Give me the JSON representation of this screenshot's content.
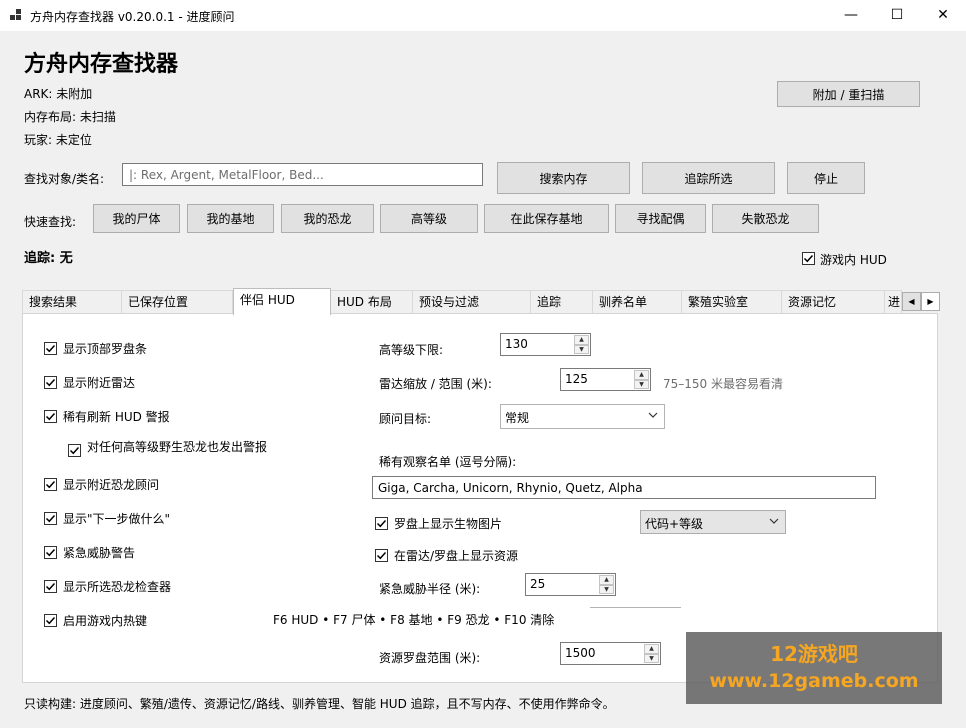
{
  "window": {
    "title": "方舟内存查找器 v0.20.0.1 - 进度顾问",
    "minimize": "—",
    "maximize": "☐",
    "close": "✕"
  },
  "header": {
    "app_title": "方舟内存查找器",
    "ark_status": "ARK: 未附加",
    "memory_status": "内存布局: 未扫描",
    "player_status": "玩家: 未定位",
    "attach_button": "附加 / 重扫描"
  },
  "search": {
    "label": "查找对象/类名:",
    "placeholder": "如: Rex, Argent, MetalFloor, Bed...",
    "placeholder_visible": "|: Rex, Argent, MetalFloor, Bed...",
    "search_button": "搜索内存",
    "track_button": "追踪所选",
    "stop_button": "停止"
  },
  "quick": {
    "label": "快速查找:",
    "buttons": [
      "我的尸体",
      "我的基地",
      "我的恐龙",
      "高等级",
      "在此保存基地",
      "寻找配偶",
      "失散恐龙"
    ]
  },
  "tracking": {
    "label": "追踪: 无",
    "ingame_hud_label": "游戏内 HUD",
    "ingame_hud_checked": true
  },
  "tabs": [
    "搜索结果",
    "已保存位置",
    "伴侣 HUD",
    "HUD 布局",
    "预设与过滤",
    "追踪",
    "驯养名单",
    "繁殖实验室",
    "资源记忆",
    "进"
  ],
  "active_tab": "伴侣 HUD",
  "left_options": [
    {
      "label": "显示顶部罗盘条",
      "checked": true
    },
    {
      "label": "显示附近雷达",
      "checked": true
    },
    {
      "label": "稀有刷新 HUD 警报",
      "checked": true
    },
    {
      "label": "对任何高等级野生恐龙也发出警报",
      "checked": true
    },
    {
      "label": "显示附近恐龙顾问",
      "checked": true
    },
    {
      "label": "显示\"下一步做什么\"",
      "checked": true
    },
    {
      "label": "紧急威胁警告",
      "checked": true
    },
    {
      "label": "显示所选恐龙检查器",
      "checked": true
    },
    {
      "label": "启用游戏内热键",
      "checked": true
    }
  ],
  "right_options": {
    "high_level_label": "高等级下限:",
    "high_level_value": "130",
    "radar_label": "雷达缩放 / 范围 (米):",
    "radar_value": "125",
    "radar_hint": "75–150 米最容易看清",
    "advisor_label": "顾问目标:",
    "advisor_value": "常规",
    "watchlist_label": "稀有观察名单 (逗号分隔):",
    "watchlist_value": "Giga, Carcha, Unicorn, Rhynio, Quetz, Alpha",
    "creature_pic_label": "罗盘上显示生物图片",
    "creature_pic_checked": true,
    "creature_pic_mode": "代码+等级",
    "resources_label": "在雷达/罗盘上显示资源",
    "resources_checked": true,
    "threat_radius_label": "紧急威胁半径 (米):",
    "threat_radius_value": "25",
    "hotkeys_text": "F6 HUD • F7 尸体 • F8 基地 • F9 恐龙 • F10 清除",
    "resource_compass_label": "资源罗盘范围 (米):",
    "resource_compass_value": "1500"
  },
  "footer": {
    "status": "只读构建: 进度顾问、繁殖/遗传、资源记忆/路线、驯养管理、智能 HUD 追踪，且不写内存、不使用作弊命令。"
  },
  "watermark": {
    "line1": "12游戏吧",
    "line2": "www.12gameb.com"
  }
}
